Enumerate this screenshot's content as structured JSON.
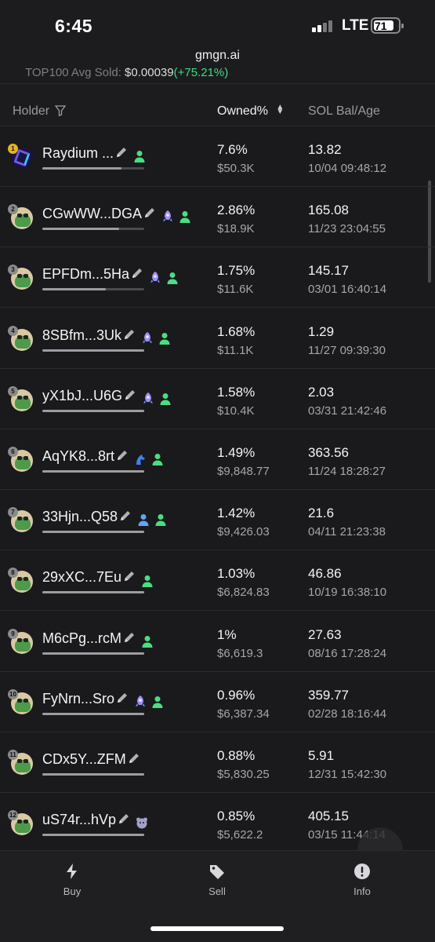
{
  "status": {
    "time": "6:45",
    "network": "LTE",
    "battery": "71"
  },
  "browser": {
    "url": "gmgn.ai"
  },
  "summary": {
    "label": "TOP100 Avg Sold:",
    "value": "$0.00039",
    "change": "(+75.21%)"
  },
  "table": {
    "headers": {
      "holder": "Holder",
      "owned": "Owned%",
      "sol": "SOL Bal/Age"
    },
    "rows": [
      {
        "rank": "1",
        "name": "Raydium ...",
        "tags": [
          "person"
        ],
        "bar": 0.78,
        "pct": "7.6%",
        "usd": "$50.3K",
        "sol": "13.82",
        "age": "10/04 09:48:12"
      },
      {
        "rank": "2",
        "name": "CGwWW...DGA",
        "tags": [
          "rocket",
          "person"
        ],
        "bar": 0.75,
        "pct": "2.86%",
        "usd": "$18.9K",
        "sol": "165.08",
        "age": "11/23 23:04:55"
      },
      {
        "rank": "3",
        "name": "EPFDm...5Ha",
        "tags": [
          "rocket",
          "person"
        ],
        "bar": 0.62,
        "pct": "1.75%",
        "usd": "$11.6K",
        "sol": "145.17",
        "age": "03/01 16:40:14"
      },
      {
        "rank": "4",
        "name": "8SBfm...3Uk",
        "tags": [
          "rocket",
          "person"
        ],
        "bar": 1.0,
        "pct": "1.68%",
        "usd": "$11.1K",
        "sol": "1.29",
        "age": "11/27 09:39:30"
      },
      {
        "rank": "5",
        "name": "yX1bJ...U6G",
        "tags": [
          "rocket",
          "person"
        ],
        "bar": 1.0,
        "pct": "1.58%",
        "usd": "$10.4K",
        "sol": "2.03",
        "age": "03/31 21:42:46"
      },
      {
        "rank": "6",
        "name": "AqYK8...8rt",
        "tags": [
          "horse",
          "person"
        ],
        "bar": 1.0,
        "pct": "1.49%",
        "usd": "$9,848.77",
        "sol": "363.56",
        "age": "11/24 18:28:27"
      },
      {
        "rank": "7",
        "name": "33Hjn...Q58",
        "tags": [
          "person-blue",
          "person"
        ],
        "bar": 1.0,
        "pct": "1.42%",
        "usd": "$9,426.03",
        "sol": "21.6",
        "age": "04/11 21:23:38"
      },
      {
        "rank": "8",
        "name": "29xXC...7Eu",
        "tags": [
          "person"
        ],
        "bar": 1.0,
        "pct": "1.03%",
        "usd": "$6,824.83",
        "sol": "46.86",
        "age": "10/19 16:38:10"
      },
      {
        "rank": "9",
        "name": "M6cPg...rcM",
        "tags": [
          "person"
        ],
        "bar": 1.0,
        "pct": "1%",
        "usd": "$6,619.3",
        "sol": "27.63",
        "age": "08/16 17:28:24"
      },
      {
        "rank": "10",
        "name": "FyNrn...Sro",
        "tags": [
          "rocket",
          "person"
        ],
        "bar": 1.0,
        "pct": "0.96%",
        "usd": "$6,387.34",
        "sol": "359.77",
        "age": "02/28 18:16:44"
      },
      {
        "rank": "11",
        "name": "CDx5Y...ZFM",
        "tags": [],
        "bar": 1.0,
        "pct": "0.88%",
        "usd": "$5,830.25",
        "sol": "5.91",
        "age": "12/31 15:42:30"
      },
      {
        "rank": "12",
        "name": "uS74r...hVp",
        "tags": [
          "bear"
        ],
        "bar": 1.0,
        "pct": "0.85%",
        "usd": "$5,622.2",
        "sol": "405.15",
        "age": "03/15 11:44:14"
      }
    ]
  },
  "tabs": [
    {
      "label": "Buy",
      "icon": "lightning-icon"
    },
    {
      "label": "Sell",
      "icon": "tag-icon"
    },
    {
      "label": "Info",
      "icon": "info-icon"
    }
  ]
}
